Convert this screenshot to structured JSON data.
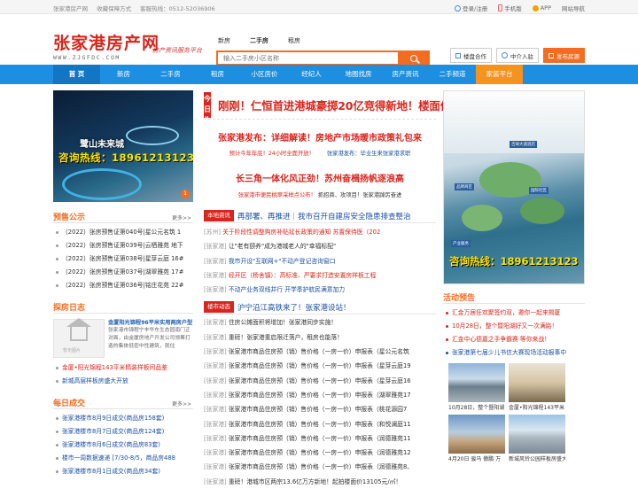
{
  "topbar": {
    "site": "张家港房产网",
    "fav": "收藏保障方式",
    "hotline": "客服热线：0512-52036906",
    "login": "登录/注册",
    "mobile": "手机版",
    "app": "APP",
    "sitemap": "网站导航"
  },
  "logo": {
    "cn": "张家港房产网",
    "en": "WWW.ZJGFDC.COM",
    "slogan": "房产资讯服务平台"
  },
  "search": {
    "tabs": [
      "新房",
      "二手房",
      "租房"
    ],
    "placeholder": "输入二手房小区名称"
  },
  "header_buttons": {
    "shop": "楼盘合作",
    "agent": "中介入驻",
    "post": "发布房源"
  },
  "nav": [
    "首 页",
    "新房",
    "二手房",
    "租房",
    "小区房价",
    "经纪人",
    "地图找房",
    "房产资讯",
    "二手频道",
    "家装平台"
  ],
  "left": {
    "banner": {
      "title": "鹭山未来城",
      "hotline": "咨询热线：18961213123",
      "index": "1"
    },
    "presale": {
      "title": "预售公示",
      "more": "更多>>",
      "items": [
        "（2022）张房预售证第040号|星公元名筑 1",
        "（2022）张房预售证第039号|云栖雅苑 地下",
        "（2022）张房预售证第038号|星芽云庭 16#",
        "（2022）张房预售证第037号|湖翠雅苑 17#",
        "（2022）张房预售证第036号|铭庄花苑 22#"
      ]
    },
    "diary": {
      "title": "探房日志",
      "thumb_caption": "暂无图片",
      "headline": "金厦阳光锦程96平米实用两房户型",
      "body": "张家港市锦程宁丰华东生态园南门正对面，由金厦房地产开发公司领筹打造的集体低密中性建筑，就住",
      "items": [
        "金厦•阳光锦程143平米精装样板间品鉴",
        "新城高层样板房盛大开放"
      ]
    },
    "deals": {
      "title": "每日成交",
      "more": "更多>>",
      "items": [
        "张家港楼市8月9日成交(商品房158套)",
        "张家港楼市8月7日成交(商品房124套)",
        "张家港楼市8月6日成交(商品房83套)",
        "楼市一周数据速递 [7/30-8/5，商品房488",
        "张家港楼市8月1日成交(商品房34套)"
      ]
    }
  },
  "middle": {
    "today_label": "今日头条",
    "headline": "刚刚！仁恒首进港城豪掷20亿竞得新地！楼面价",
    "news2": {
      "title": "张家港发布：详细解读！房地产市场暖市政策礼包来",
      "sub_red": "预计今年年底！24小时全面开放！",
      "sub_blue": "张家港发布：毕业生来张家港求职"
    },
    "news3": {
      "title": "长三角一体化风正劲！苏州奋楫扬帆逐浪高",
      "sub_red": "张家港市便民桃翠采样点公布！",
      "sub_rest": "抓招商、攻项目！张家港踔厉奋进"
    },
    "local": {
      "tag": "本地资讯",
      "title": "再部署、再推进｜我市召开自建房安全隐患排查整治",
      "items": [
        {
          "prefix": "[苏州]",
          "text": "关于阶段性调整购房补贴延长政策的通知 苏置保待医（202",
          "color": "red"
        },
        {
          "prefix": "[张家港]",
          "text": "让\"老有颐养\"成为港城老人的\"幸福标配\"",
          "color": ""
        },
        {
          "prefix": "[张家港]",
          "text": "我市开设\"互联网+\"不动产登记咨询窗口",
          "color": "blue"
        },
        {
          "prefix": "[张家港]",
          "text": "经开区（杨舍镇）：高标准、严要求打造安置房样板工程",
          "color": "red"
        },
        {
          "prefix": "[张家港]",
          "text": "不动产业务双线并行 开学季护航民满意加力",
          "color": "blue"
        }
      ]
    },
    "market": {
      "tag": "楼市动态",
      "title": "沪宁沿江高铁来了！张家港设站！",
      "items": [
        {
          "prefix": "[张家港]",
          "text": "住房公摊面积将增加！张家港同步实施！"
        },
        {
          "prefix": "[张家港]",
          "text": "重磅！张家港重启限迁落户，租房也能落！"
        },
        {
          "prefix": "[张家港]",
          "text": "张家港市商品住房预（销）售价格（一房一价）申报表（星公元名筑"
        },
        {
          "prefix": "[张家港]",
          "text": "张家港市商品住房预（销）售价格（一房一价）申报表（星芽云庭19"
        },
        {
          "prefix": "[张家港]",
          "text": "张家港市商品住房预（销）售价格（一房一价）申报表（星芽云庭16"
        },
        {
          "prefix": "[张家港]",
          "text": "张家港市商品住房预（销）售价格（一房一价）申报表（湖翠雅苑17"
        },
        {
          "prefix": "[张家港]",
          "text": "张家港市商品住房预（销）售价格（一房一价）申报表（桃花源园7"
        },
        {
          "prefix": "[张家港]",
          "text": "张家港市商品住房预（销）售价格（一房一价）申报表（和悦澜庭11"
        },
        {
          "prefix": "[张家港]",
          "text": "张家港市商品住房预（销）售价格（一房一价）申报表（润德雅苑11"
        },
        {
          "prefix": "[张家港]",
          "text": "张家港市商品住房预（销）售价格（一房一价）申报表（润德雅苑12"
        },
        {
          "prefix": "[张家港]",
          "text": "张家港市商品住房预（销）售价格（一房一价）申报表（润德雅苑8、"
        },
        {
          "prefix": "[张家港]",
          "text": "重磅！港城市区两宗13.6亿万方新地！起拍楼面价13105元/㎡！"
        }
      ]
    }
  },
  "right": {
    "pic_hotline": "咨询热线：18961213123",
    "pic_labels": [
      "吉祥大道酒店",
      "品牌商区",
      "国际社区",
      "产业服务"
    ],
    "activity": {
      "title": "活动预告",
      "items": [
        {
          "text": "汇金万居狂欢聚签约双，邀你一起来揭厦",
          "color": "red"
        },
        {
          "text": "10月28日，整个暨阳湖好又一次满路！",
          "color": "red"
        },
        {
          "text": "汇金中心德嘉之手争霸赛 等你来战！",
          "color": "red"
        },
        {
          "text": "张家港第七届少儿书信大赛现场活动报事中",
          "color": "blue"
        }
      ]
    },
    "gallery": [
      {
        "caption": "10月28日，整个暨阳湖"
      },
      {
        "caption": "金厦•阳光锦程143平米"
      },
      {
        "caption": "4月20日 骏马 傲鹏 万"
      },
      {
        "caption": "新城风铃公园样板房盛大"
      }
    ]
  }
}
